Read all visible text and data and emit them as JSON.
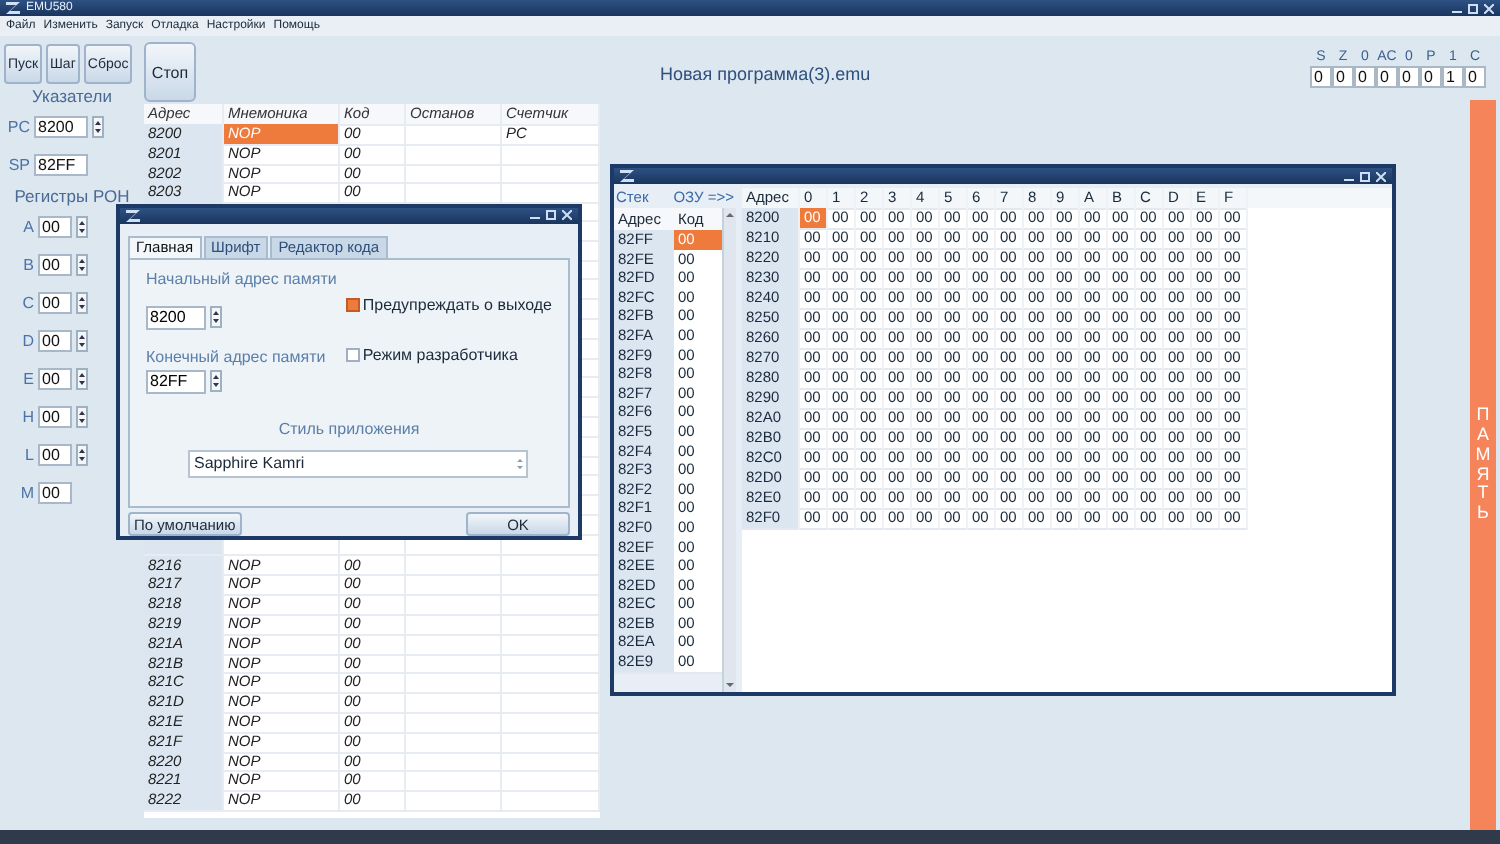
{
  "window": {
    "title": "EMU580"
  },
  "menu": [
    "Файл",
    "Изменить",
    "Запуск",
    "Отладка",
    "Настройки",
    "Помощь"
  ],
  "toolbar": [
    {
      "label": "Пуск",
      "kind": "small"
    },
    {
      "label": "Шаг",
      "kind": "small"
    },
    {
      "label": "Сброс",
      "kind": "small"
    },
    {
      "label": "Стоп",
      "kind": "large"
    }
  ],
  "document_title": "Новая программа(3).emu",
  "flags": [
    {
      "label": "S",
      "value": "0"
    },
    {
      "label": "Z",
      "value": "0"
    },
    {
      "label": "0",
      "value": "0"
    },
    {
      "label": "AC",
      "value": "0"
    },
    {
      "label": "0",
      "value": "0"
    },
    {
      "label": "P",
      "value": "0"
    },
    {
      "label": "1",
      "value": "1"
    },
    {
      "label": "C",
      "value": "0"
    }
  ],
  "pointers": {
    "title": "Указатели",
    "items": [
      {
        "name": "PC",
        "value": "8200",
        "spinner": true
      },
      {
        "name": "SP",
        "value": "82FF",
        "spinner": false
      }
    ]
  },
  "registers": {
    "title": "Регистры РОН",
    "items": [
      {
        "name": "A",
        "value": "00",
        "spinner": true
      },
      {
        "name": "B",
        "value": "00",
        "spinner": true
      },
      {
        "name": "C",
        "value": "00",
        "spinner": true
      },
      {
        "name": "D",
        "value": "00",
        "spinner": true
      },
      {
        "name": "E",
        "value": "00",
        "spinner": true
      },
      {
        "name": "H",
        "value": "00",
        "spinner": true
      },
      {
        "name": "L",
        "value": "00",
        "spinner": true
      },
      {
        "name": "M",
        "value": "00",
        "spinner": false
      }
    ]
  },
  "program": {
    "columns": [
      "Адрес",
      "Мнемоника",
      "Код",
      "Останов",
      "Счетчик"
    ],
    "rows_top": [
      {
        "address": "8200",
        "mnemonic": "NOP",
        "code": "00",
        "counter": "PC",
        "selected": true
      },
      {
        "address": "8201",
        "mnemonic": "NOP",
        "code": "00",
        "selected": false
      },
      {
        "address": "8202",
        "mnemonic": "NOP",
        "code": "00",
        "selected": false
      },
      {
        "address": "8203",
        "mnemonic": "NOP",
        "code": "00",
        "selected": false
      }
    ],
    "rows_bottom": [
      {
        "address": "8216",
        "mnemonic": "NOP",
        "code": "00",
        "selected": false
      },
      {
        "address": "8217",
        "mnemonic": "NOP",
        "code": "00",
        "selected": false
      },
      {
        "address": "8218",
        "mnemonic": "NOP",
        "code": "00",
        "selected": false
      },
      {
        "address": "8219",
        "mnemonic": "NOP",
        "code": "00",
        "selected": false
      },
      {
        "address": "821A",
        "mnemonic": "NOP",
        "code": "00",
        "selected": false
      },
      {
        "address": "821B",
        "mnemonic": "NOP",
        "code": "00",
        "selected": false
      },
      {
        "address": "821C",
        "mnemonic": "NOP",
        "code": "00",
        "selected": false
      },
      {
        "address": "821D",
        "mnemonic": "NOP",
        "code": "00",
        "selected": false
      },
      {
        "address": "821E",
        "mnemonic": "NOP",
        "code": "00",
        "selected": false
      },
      {
        "address": "821F",
        "mnemonic": "NOP",
        "code": "00",
        "selected": false
      },
      {
        "address": "8220",
        "mnemonic": "NOP",
        "code": "00",
        "selected": false
      },
      {
        "address": "8221",
        "mnemonic": "NOP",
        "code": "00",
        "selected": false
      },
      {
        "address": "8222",
        "mnemonic": "NOP",
        "code": "00",
        "selected": false
      }
    ]
  },
  "side_button": "ПАМЯТЬ",
  "settings_dialog": {
    "tabs": [
      {
        "label": "Главная",
        "selected": true
      },
      {
        "label": "Шрифт",
        "selected": false
      },
      {
        "label": "Редактор кода",
        "selected": false
      }
    ],
    "start_label": "Начальный адрес памяти",
    "start_value": "8200",
    "end_label": "Конечный адрес памяти",
    "end_value": "82FF",
    "checkboxes": [
      {
        "label": "Предупреждать о выходе",
        "checked": true
      },
      {
        "label": "Режим разработчика",
        "checked": false
      }
    ],
    "style_label": "Стиль приложения",
    "style_value": "Sapphire Kamri",
    "buttons": [
      "По умолчанию",
      "OK"
    ]
  },
  "memory_window": {
    "stack": {
      "title": "Стек",
      "link": "ОЗУ =>>",
      "columns": [
        "Адрес",
        "Код"
      ],
      "rows": [
        {
          "address": "82FF",
          "code": "00",
          "selected": true
        },
        {
          "address": "82FE",
          "code": "00",
          "selected": false
        },
        {
          "address": "82FD",
          "code": "00",
          "selected": false
        },
        {
          "address": "82FC",
          "code": "00",
          "selected": false
        },
        {
          "address": "82FB",
          "code": "00",
          "selected": false
        },
        {
          "address": "82FA",
          "code": "00",
          "selected": false
        },
        {
          "address": "82F9",
          "code": "00",
          "selected": false
        },
        {
          "address": "82F8",
          "code": "00",
          "selected": false
        },
        {
          "address": "82F7",
          "code": "00",
          "selected": false
        },
        {
          "address": "82F6",
          "code": "00",
          "selected": false
        },
        {
          "address": "82F5",
          "code": "00",
          "selected": false
        },
        {
          "address": "82F4",
          "code": "00",
          "selected": false
        },
        {
          "address": "82F3",
          "code": "00",
          "selected": false
        },
        {
          "address": "82F2",
          "code": "00",
          "selected": false
        },
        {
          "address": "82F1",
          "code": "00",
          "selected": false
        },
        {
          "address": "82F0",
          "code": "00",
          "selected": false
        },
        {
          "address": "82EF",
          "code": "00",
          "selected": false
        },
        {
          "address": "82EE",
          "code": "00",
          "selected": false
        },
        {
          "address": "82ED",
          "code": "00",
          "selected": false
        },
        {
          "address": "82EC",
          "code": "00",
          "selected": false
        },
        {
          "address": "82EB",
          "code": "00",
          "selected": false
        },
        {
          "address": "82EA",
          "code": "00",
          "selected": false
        },
        {
          "address": "82E9",
          "code": "00",
          "selected": false
        }
      ]
    },
    "ram": {
      "address_header": "Адрес",
      "columns": [
        "0",
        "1",
        "2",
        "3",
        "4",
        "5",
        "6",
        "7",
        "8",
        "9",
        "A",
        "B",
        "C",
        "D",
        "E",
        "F"
      ],
      "rows": [
        {
          "address": "8200",
          "cells": [
            {
              "value": "00",
              "selected": true
            },
            {
              "value": "00",
              "selected": false
            },
            {
              "value": "00",
              "selected": false
            },
            {
              "value": "00",
              "selected": false
            },
            {
              "value": "00",
              "selected": false
            },
            {
              "value": "00",
              "selected": false
            },
            {
              "value": "00",
              "selected": false
            },
            {
              "value": "00",
              "selected": false
            },
            {
              "value": "00",
              "selected": false
            },
            {
              "value": "00",
              "selected": false
            },
            {
              "value": "00",
              "selected": false
            },
            {
              "value": "00",
              "selected": false
            },
            {
              "value": "00",
              "selected": false
            },
            {
              "value": "00",
              "selected": false
            },
            {
              "value": "00",
              "selected": false
            },
            {
              "value": "00",
              "selected": false
            }
          ]
        },
        {
          "address": "8210",
          "cells": [
            {
              "value": "00",
              "selected": false
            },
            {
              "value": "00",
              "selected": false
            },
            {
              "value": "00",
              "selected": false
            },
            {
              "value": "00",
              "selected": false
            },
            {
              "value": "00",
              "selected": false
            },
            {
              "value": "00",
              "selected": false
            },
            {
              "value": "00",
              "selected": false
            },
            {
              "value": "00",
              "selected": false
            },
            {
              "value": "00",
              "selected": false
            },
            {
              "value": "00",
              "selected": false
            },
            {
              "value": "00",
              "selected": false
            },
            {
              "value": "00",
              "selected": false
            },
            {
              "value": "00",
              "selected": false
            },
            {
              "value": "00",
              "selected": false
            },
            {
              "value": "00",
              "selected": false
            },
            {
              "value": "00",
              "selected": false
            }
          ]
        },
        {
          "address": "8220",
          "cells": [
            {
              "value": "00",
              "selected": false
            },
            {
              "value": "00",
              "selected": false
            },
            {
              "value": "00",
              "selected": false
            },
            {
              "value": "00",
              "selected": false
            },
            {
              "value": "00",
              "selected": false
            },
            {
              "value": "00",
              "selected": false
            },
            {
              "value": "00",
              "selected": false
            },
            {
              "value": "00",
              "selected": false
            },
            {
              "value": "00",
              "selected": false
            },
            {
              "value": "00",
              "selected": false
            },
            {
              "value": "00",
              "selected": false
            },
            {
              "value": "00",
              "selected": false
            },
            {
              "value": "00",
              "selected": false
            },
            {
              "value": "00",
              "selected": false
            },
            {
              "value": "00",
              "selected": false
            },
            {
              "value": "00",
              "selected": false
            }
          ]
        },
        {
          "address": "8230",
          "cells": [
            {
              "value": "00",
              "selected": false
            },
            {
              "value": "00",
              "selected": false
            },
            {
              "value": "00",
              "selected": false
            },
            {
              "value": "00",
              "selected": false
            },
            {
              "value": "00",
              "selected": false
            },
            {
              "value": "00",
              "selected": false
            },
            {
              "value": "00",
              "selected": false
            },
            {
              "value": "00",
              "selected": false
            },
            {
              "value": "00",
              "selected": false
            },
            {
              "value": "00",
              "selected": false
            },
            {
              "value": "00",
              "selected": false
            },
            {
              "value": "00",
              "selected": false
            },
            {
              "value": "00",
              "selected": false
            },
            {
              "value": "00",
              "selected": false
            },
            {
              "value": "00",
              "selected": false
            },
            {
              "value": "00",
              "selected": false
            }
          ]
        },
        {
          "address": "8240",
          "cells": [
            {
              "value": "00",
              "selected": false
            },
            {
              "value": "00",
              "selected": false
            },
            {
              "value": "00",
              "selected": false
            },
            {
              "value": "00",
              "selected": false
            },
            {
              "value": "00",
              "selected": false
            },
            {
              "value": "00",
              "selected": false
            },
            {
              "value": "00",
              "selected": false
            },
            {
              "value": "00",
              "selected": false
            },
            {
              "value": "00",
              "selected": false
            },
            {
              "value": "00",
              "selected": false
            },
            {
              "value": "00",
              "selected": false
            },
            {
              "value": "00",
              "selected": false
            },
            {
              "value": "00",
              "selected": false
            },
            {
              "value": "00",
              "selected": false
            },
            {
              "value": "00",
              "selected": false
            },
            {
              "value": "00",
              "selected": false
            }
          ]
        },
        {
          "address": "8250",
          "cells": [
            {
              "value": "00",
              "selected": false
            },
            {
              "value": "00",
              "selected": false
            },
            {
              "value": "00",
              "selected": false
            },
            {
              "value": "00",
              "selected": false
            },
            {
              "value": "00",
              "selected": false
            },
            {
              "value": "00",
              "selected": false
            },
            {
              "value": "00",
              "selected": false
            },
            {
              "value": "00",
              "selected": false
            },
            {
              "value": "00",
              "selected": false
            },
            {
              "value": "00",
              "selected": false
            },
            {
              "value": "00",
              "selected": false
            },
            {
              "value": "00",
              "selected": false
            },
            {
              "value": "00",
              "selected": false
            },
            {
              "value": "00",
              "selected": false
            },
            {
              "value": "00",
              "selected": false
            },
            {
              "value": "00",
              "selected": false
            }
          ]
        },
        {
          "address": "8260",
          "cells": [
            {
              "value": "00",
              "selected": false
            },
            {
              "value": "00",
              "selected": false
            },
            {
              "value": "00",
              "selected": false
            },
            {
              "value": "00",
              "selected": false
            },
            {
              "value": "00",
              "selected": false
            },
            {
              "value": "00",
              "selected": false
            },
            {
              "value": "00",
              "selected": false
            },
            {
              "value": "00",
              "selected": false
            },
            {
              "value": "00",
              "selected": false
            },
            {
              "value": "00",
              "selected": false
            },
            {
              "value": "00",
              "selected": false
            },
            {
              "value": "00",
              "selected": false
            },
            {
              "value": "00",
              "selected": false
            },
            {
              "value": "00",
              "selected": false
            },
            {
              "value": "00",
              "selected": false
            },
            {
              "value": "00",
              "selected": false
            }
          ]
        },
        {
          "address": "8270",
          "cells": [
            {
              "value": "00",
              "selected": false
            },
            {
              "value": "00",
              "selected": false
            },
            {
              "value": "00",
              "selected": false
            },
            {
              "value": "00",
              "selected": false
            },
            {
              "value": "00",
              "selected": false
            },
            {
              "value": "00",
              "selected": false
            },
            {
              "value": "00",
              "selected": false
            },
            {
              "value": "00",
              "selected": false
            },
            {
              "value": "00",
              "selected": false
            },
            {
              "value": "00",
              "selected": false
            },
            {
              "value": "00",
              "selected": false
            },
            {
              "value": "00",
              "selected": false
            },
            {
              "value": "00",
              "selected": false
            },
            {
              "value": "00",
              "selected": false
            },
            {
              "value": "00",
              "selected": false
            },
            {
              "value": "00",
              "selected": false
            }
          ]
        },
        {
          "address": "8280",
          "cells": [
            {
              "value": "00",
              "selected": false
            },
            {
              "value": "00",
              "selected": false
            },
            {
              "value": "00",
              "selected": false
            },
            {
              "value": "00",
              "selected": false
            },
            {
              "value": "00",
              "selected": false
            },
            {
              "value": "00",
              "selected": false
            },
            {
              "value": "00",
              "selected": false
            },
            {
              "value": "00",
              "selected": false
            },
            {
              "value": "00",
              "selected": false
            },
            {
              "value": "00",
              "selected": false
            },
            {
              "value": "00",
              "selected": false
            },
            {
              "value": "00",
              "selected": false
            },
            {
              "value": "00",
              "selected": false
            },
            {
              "value": "00",
              "selected": false
            },
            {
              "value": "00",
              "selected": false
            },
            {
              "value": "00",
              "selected": false
            }
          ]
        },
        {
          "address": "8290",
          "cells": [
            {
              "value": "00",
              "selected": false
            },
            {
              "value": "00",
              "selected": false
            },
            {
              "value": "00",
              "selected": false
            },
            {
              "value": "00",
              "selected": false
            },
            {
              "value": "00",
              "selected": false
            },
            {
              "value": "00",
              "selected": false
            },
            {
              "value": "00",
              "selected": false
            },
            {
              "value": "00",
              "selected": false
            },
            {
              "value": "00",
              "selected": false
            },
            {
              "value": "00",
              "selected": false
            },
            {
              "value": "00",
              "selected": false
            },
            {
              "value": "00",
              "selected": false
            },
            {
              "value": "00",
              "selected": false
            },
            {
              "value": "00",
              "selected": false
            },
            {
              "value": "00",
              "selected": false
            },
            {
              "value": "00",
              "selected": false
            }
          ]
        },
        {
          "address": "82A0",
          "cells": [
            {
              "value": "00",
              "selected": false
            },
            {
              "value": "00",
              "selected": false
            },
            {
              "value": "00",
              "selected": false
            },
            {
              "value": "00",
              "selected": false
            },
            {
              "value": "00",
              "selected": false
            },
            {
              "value": "00",
              "selected": false
            },
            {
              "value": "00",
              "selected": false
            },
            {
              "value": "00",
              "selected": false
            },
            {
              "value": "00",
              "selected": false
            },
            {
              "value": "00",
              "selected": false
            },
            {
              "value": "00",
              "selected": false
            },
            {
              "value": "00",
              "selected": false
            },
            {
              "value": "00",
              "selected": false
            },
            {
              "value": "00",
              "selected": false
            },
            {
              "value": "00",
              "selected": false
            },
            {
              "value": "00",
              "selected": false
            }
          ]
        },
        {
          "address": "82B0",
          "cells": [
            {
              "value": "00",
              "selected": false
            },
            {
              "value": "00",
              "selected": false
            },
            {
              "value": "00",
              "selected": false
            },
            {
              "value": "00",
              "selected": false
            },
            {
              "value": "00",
              "selected": false
            },
            {
              "value": "00",
              "selected": false
            },
            {
              "value": "00",
              "selected": false
            },
            {
              "value": "00",
              "selected": false
            },
            {
              "value": "00",
              "selected": false
            },
            {
              "value": "00",
              "selected": false
            },
            {
              "value": "00",
              "selected": false
            },
            {
              "value": "00",
              "selected": false
            },
            {
              "value": "00",
              "selected": false
            },
            {
              "value": "00",
              "selected": false
            },
            {
              "value": "00",
              "selected": false
            },
            {
              "value": "00",
              "selected": false
            }
          ]
        },
        {
          "address": "82C0",
          "cells": [
            {
              "value": "00",
              "selected": false
            },
            {
              "value": "00",
              "selected": false
            },
            {
              "value": "00",
              "selected": false
            },
            {
              "value": "00",
              "selected": false
            },
            {
              "value": "00",
              "selected": false
            },
            {
              "value": "00",
              "selected": false
            },
            {
              "value": "00",
              "selected": false
            },
            {
              "value": "00",
              "selected": false
            },
            {
              "value": "00",
              "selected": false
            },
            {
              "value": "00",
              "selected": false
            },
            {
              "value": "00",
              "selected": false
            },
            {
              "value": "00",
              "selected": false
            },
            {
              "value": "00",
              "selected": false
            },
            {
              "value": "00",
              "selected": false
            },
            {
              "value": "00",
              "selected": false
            },
            {
              "value": "00",
              "selected": false
            }
          ]
        },
        {
          "address": "82D0",
          "cells": [
            {
              "value": "00",
              "selected": false
            },
            {
              "value": "00",
              "selected": false
            },
            {
              "value": "00",
              "selected": false
            },
            {
              "value": "00",
              "selected": false
            },
            {
              "value": "00",
              "selected": false
            },
            {
              "value": "00",
              "selected": false
            },
            {
              "value": "00",
              "selected": false
            },
            {
              "value": "00",
              "selected": false
            },
            {
              "value": "00",
              "selected": false
            },
            {
              "value": "00",
              "selected": false
            },
            {
              "value": "00",
              "selected": false
            },
            {
              "value": "00",
              "selected": false
            },
            {
              "value": "00",
              "selected": false
            },
            {
              "value": "00",
              "selected": false
            },
            {
              "value": "00",
              "selected": false
            },
            {
              "value": "00",
              "selected": false
            }
          ]
        },
        {
          "address": "82E0",
          "cells": [
            {
              "value": "00",
              "selected": false
            },
            {
              "value": "00",
              "selected": false
            },
            {
              "value": "00",
              "selected": false
            },
            {
              "value": "00",
              "selected": false
            },
            {
              "value": "00",
              "selected": false
            },
            {
              "value": "00",
              "selected": false
            },
            {
              "value": "00",
              "selected": false
            },
            {
              "value": "00",
              "selected": false
            },
            {
              "value": "00",
              "selected": false
            },
            {
              "value": "00",
              "selected": false
            },
            {
              "value": "00",
              "selected": false
            },
            {
              "value": "00",
              "selected": false
            },
            {
              "value": "00",
              "selected": false
            },
            {
              "value": "00",
              "selected": false
            },
            {
              "value": "00",
              "selected": false
            },
            {
              "value": "00",
              "selected": false
            }
          ]
        },
        {
          "address": "82F0",
          "cells": [
            {
              "value": "00",
              "selected": false
            },
            {
              "value": "00",
              "selected": false
            },
            {
              "value": "00",
              "selected": false
            },
            {
              "value": "00",
              "selected": false
            },
            {
              "value": "00",
              "selected": false
            },
            {
              "value": "00",
              "selected": false
            },
            {
              "value": "00",
              "selected": false
            },
            {
              "value": "00",
              "selected": false
            },
            {
              "value": "00",
              "selected": false
            },
            {
              "value": "00",
              "selected": false
            },
            {
              "value": "00",
              "selected": false
            },
            {
              "value": "00",
              "selected": false
            },
            {
              "value": "00",
              "selected": false
            },
            {
              "value": "00",
              "selected": false
            },
            {
              "value": "00",
              "selected": false
            },
            {
              "value": "00",
              "selected": false
            }
          ]
        }
      ]
    }
  }
}
